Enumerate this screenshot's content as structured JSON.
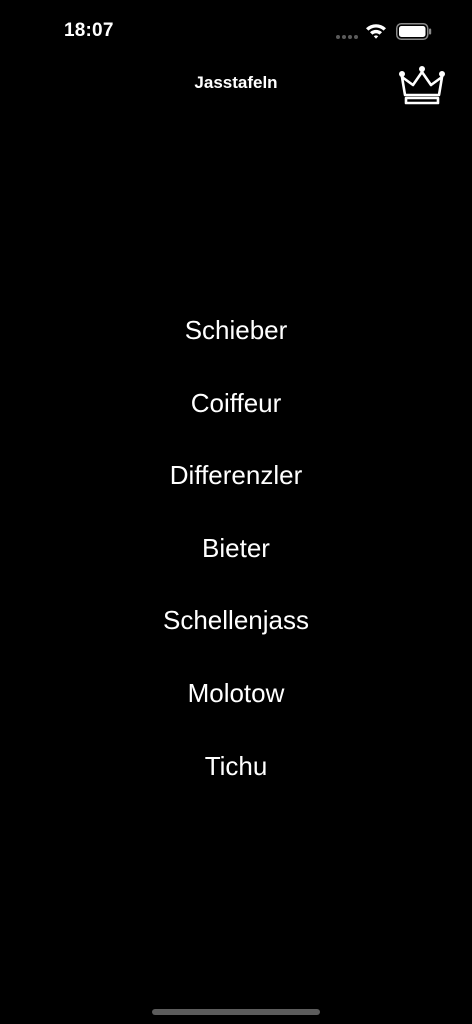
{
  "status_bar": {
    "time": "18:07"
  },
  "nav": {
    "title": "Jasstafeln",
    "crown_icon": "crown-icon"
  },
  "menu": {
    "items": [
      {
        "label": "Schieber"
      },
      {
        "label": "Coiffeur"
      },
      {
        "label": "Differenzler"
      },
      {
        "label": "Bieter"
      },
      {
        "label": "Schellenjass"
      },
      {
        "label": "Molotow"
      },
      {
        "label": "Tichu"
      }
    ]
  },
  "colors": {
    "background": "#000000",
    "text": "#ffffff",
    "home_indicator": "#5c5c5c"
  }
}
